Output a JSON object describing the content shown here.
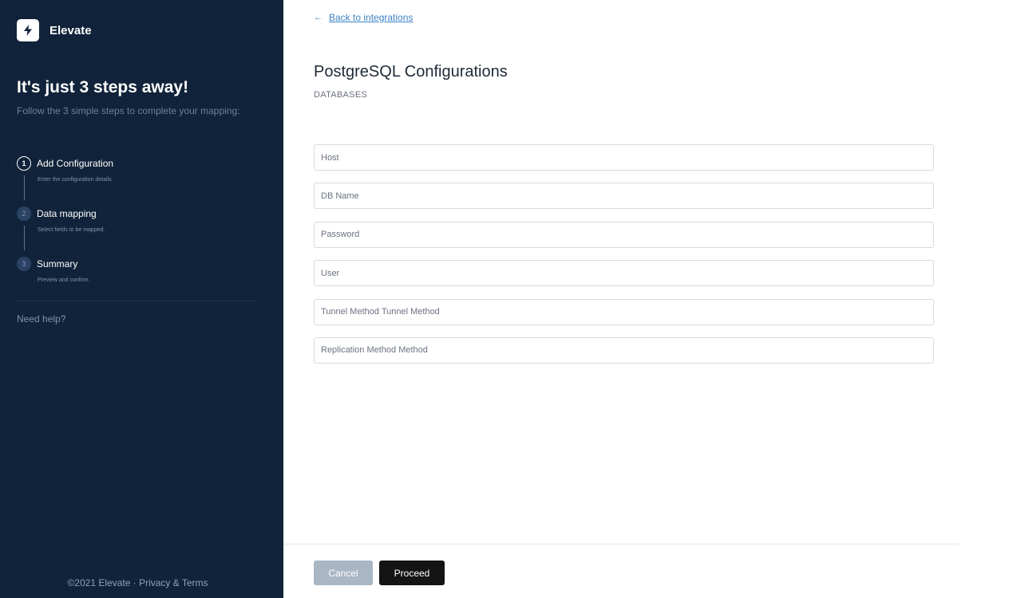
{
  "brand": {
    "name": "Elevate"
  },
  "sidebar": {
    "title": "It's just 3 steps away!",
    "subtitle": "Follow the 3 simple steps to complete your mapping:",
    "steps": [
      {
        "number": "1",
        "label": "Add Configuration",
        "description": "Enter the configuration details.",
        "state": "active"
      },
      {
        "number": "2",
        "label": "Data mapping",
        "description": "Select fields to be mapped.",
        "state": "inactive"
      },
      {
        "number": "3",
        "label": "Summary",
        "description": "Preview and confirm.",
        "state": "inactive"
      }
    ],
    "need_help": "Need help?",
    "footer": {
      "copyright": "©2021 Elevate",
      "separator": "·",
      "link": "Privacy & Terms"
    }
  },
  "main": {
    "back_link": "Back to integrations",
    "title": "PostgreSQL Configurations",
    "subtitle": "DATABASES",
    "fields": [
      {
        "placeholder": "Host",
        "value": ""
      },
      {
        "placeholder": "DB Name",
        "value": ""
      },
      {
        "placeholder": "Password",
        "value": ""
      },
      {
        "placeholder": "User",
        "value": ""
      },
      {
        "placeholder": "Tunnel Method Tunnel Method",
        "value": ""
      },
      {
        "placeholder": "Replication Method Method",
        "value": ""
      }
    ],
    "cancel_label": "Cancel",
    "proceed_label": "Proceed"
  },
  "colors": {
    "sidebar_bg": "#11233a",
    "link": "#3b82c4",
    "cancel_bg": "#a9b6c4",
    "proceed_bg": "#141414"
  }
}
